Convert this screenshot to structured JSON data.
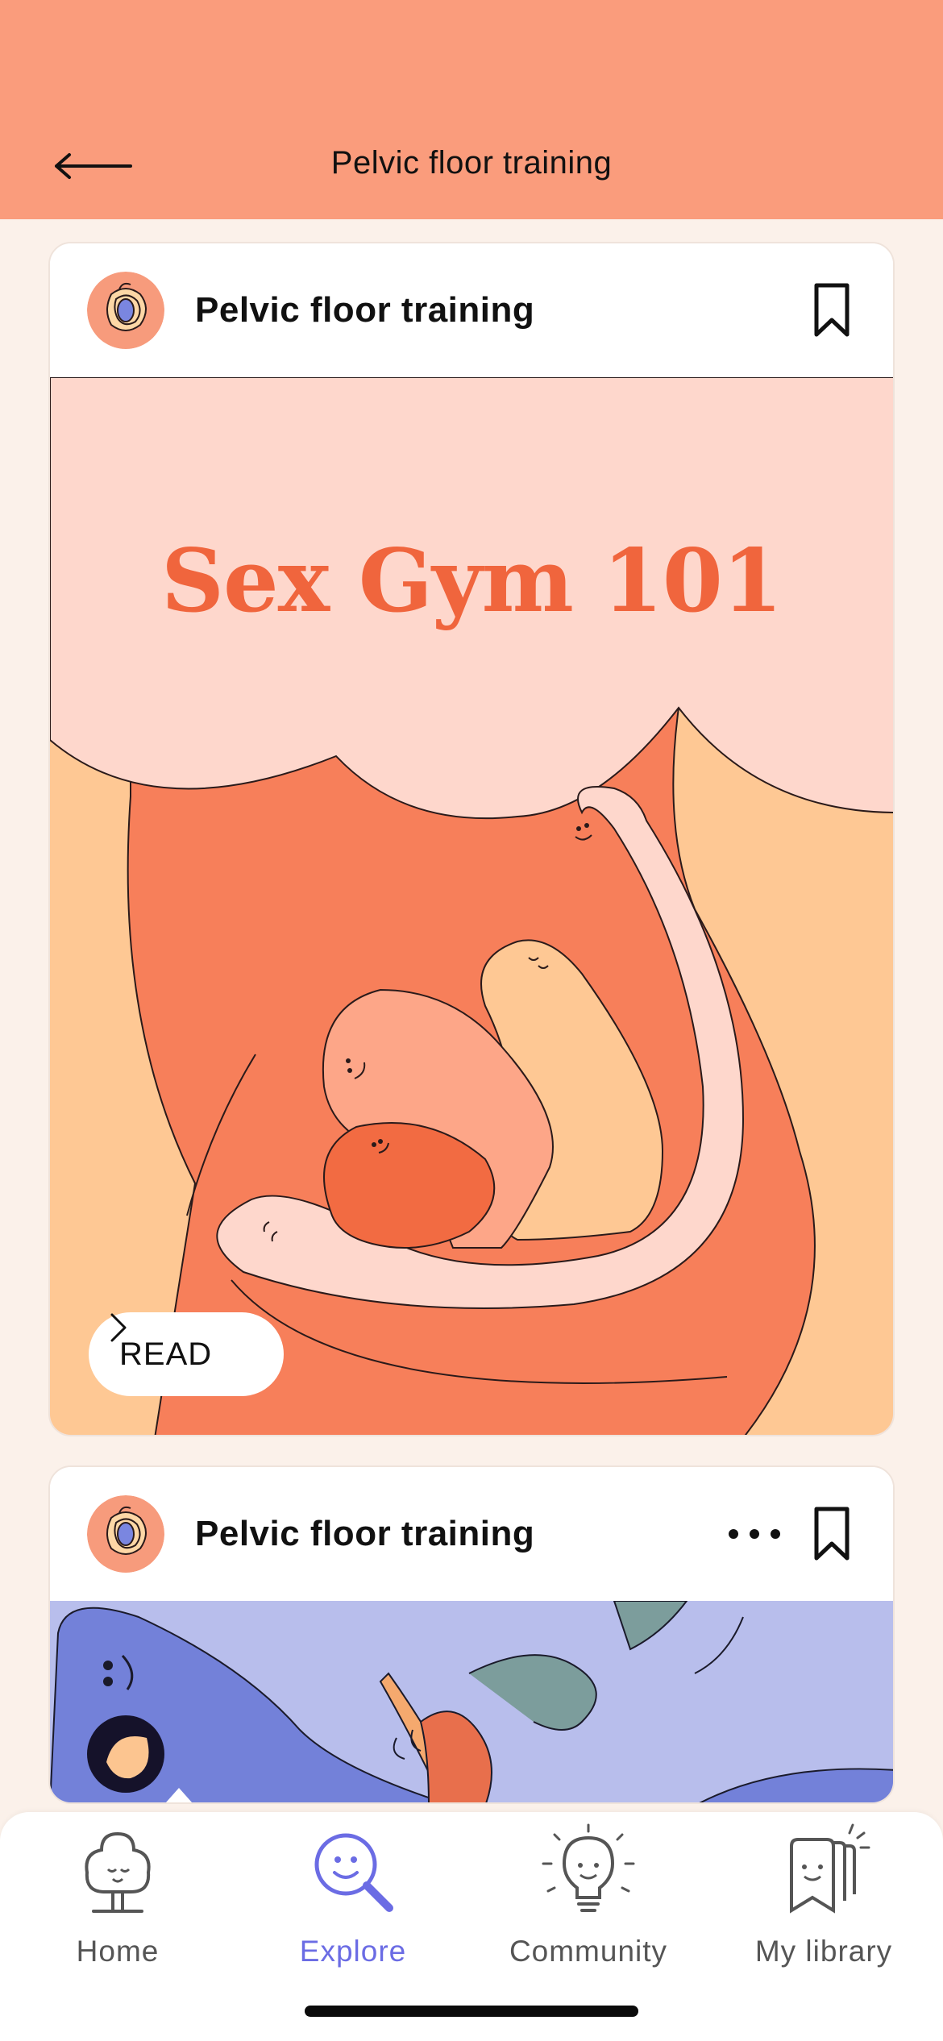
{
  "header": {
    "title": "Pelvic floor training",
    "back_icon": "arrow-left-icon",
    "background": "#FA9C7C"
  },
  "cards": [
    {
      "category": "Pelvic floor training",
      "art_title": "Sex Gym 101",
      "action_label": "READ",
      "icons": [
        "bookmark-icon",
        "chevron-right-icon"
      ]
    },
    {
      "category": "Pelvic floor training",
      "icons": [
        "more-icon",
        "bookmark-icon"
      ]
    }
  ],
  "tabbar": {
    "items": [
      {
        "label": "Home",
        "icon": "tree-icon",
        "active": false
      },
      {
        "label": "Explore",
        "icon": "magnifier-icon",
        "active": true
      },
      {
        "label": "Community",
        "icon": "lightbulb-icon",
        "active": false
      },
      {
        "label": "My library",
        "icon": "library-icon",
        "active": false
      }
    ]
  },
  "colors": {
    "accent": "#6B6CE4",
    "title_orange": "#F0653D",
    "page_bg": "#FBF1EA"
  }
}
